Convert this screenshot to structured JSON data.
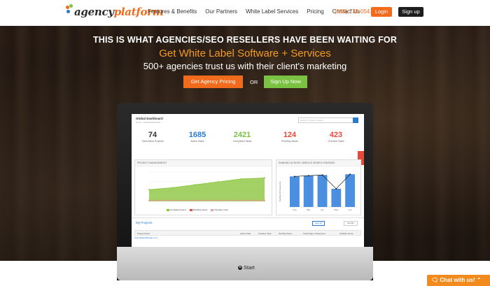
{
  "nav": {
    "logo_prefix": "agency",
    "logo_suffix": "platform",
    "links": [
      "Features & Benefits",
      "Our Partners",
      "White Label Services",
      "Pricing",
      "Contact Us"
    ],
    "phone": "(888) 736-0541",
    "login": "Login",
    "signup": "Sign up"
  },
  "hero": {
    "headline": "THIS IS WHAT AGENCIES/SEO RESELLERS HAVE BEEN WAITING FOR",
    "subheadline": "Get White Label Software + Services",
    "tagline": "500+ agencies trust us with their client's marketing",
    "cta_pricing": "Get Agency Pricing",
    "or": "OR",
    "cta_signup": "Sign Up Now"
  },
  "dashboard": {
    "title": "Global Dashboard",
    "breadcrumb": "Home  ›  Global Dashboard",
    "search_placeholder": "search in project, feature",
    "stats": [
      {
        "value": "74",
        "label": "Total Active Projects",
        "color": "#333333"
      },
      {
        "value": "1685",
        "label": "Active Tasks",
        "color": "#2a7ad0"
      },
      {
        "value": "2421",
        "label": "Completed Tasks",
        "color": "#7bc142"
      },
      {
        "value": "124",
        "label": "Pending Issues",
        "color": "#e84a3a"
      },
      {
        "value": "423",
        "label": "Overdue Tasks",
        "color": "#e84a3a"
      }
    ],
    "pm_panel_title": "PROJECT MANAGEMENT",
    "pm_legend": [
      "Completed count",
      "Pending Issues",
      "Overdue count"
    ],
    "rank_panel_title": "RANKING ACROSS VARIOUS SEARCH ENGINES",
    "rank_ylabel": "Number Of Keywords",
    "projects_title": "My Projects",
    "see_all": "See All",
    "sort_by": "Sort By",
    "columns": [
      "Project Name",
      "Active Task",
      "Overdue Task",
      "Pending Issue",
      "Total Page 1 Placement",
      "Visibility Score"
    ],
    "row_text": "SampleMetalDesign.com"
  },
  "chart_data": [
    {
      "type": "area",
      "title": "PROJECT MANAGEMENT",
      "categories": [
        "",
        "",
        "",
        "",
        "",
        ""
      ],
      "series": [
        {
          "name": "Completed count",
          "values": [
            12,
            14,
            17,
            20,
            23,
            24
          ],
          "color": "#8cc63f"
        },
        {
          "name": "Pending Issues",
          "values": [
            1,
            1,
            1,
            1,
            1,
            1
          ],
          "color": "#e84a3a"
        },
        {
          "name": "Overdue count",
          "values": [
            1,
            1,
            1,
            1,
            1,
            1
          ],
          "color": "#f0a0a0"
        }
      ],
      "ylim": [
        0,
        30
      ]
    },
    {
      "type": "bar",
      "title": "RANKING ACROSS VARIOUS SEARCH ENGINES",
      "categories": [
        "Feb",
        "Mar",
        "Apr",
        "May",
        "Jun"
      ],
      "values": [
        420,
        430,
        440,
        250,
        450
      ],
      "line": [
        420,
        430,
        440,
        250,
        450
      ],
      "ylabel": "Number Of Keywords",
      "ylim": [
        0,
        500
      ]
    }
  ],
  "chat": {
    "label": "Chat with us!"
  },
  "monitor": {
    "start_label": "Start"
  }
}
